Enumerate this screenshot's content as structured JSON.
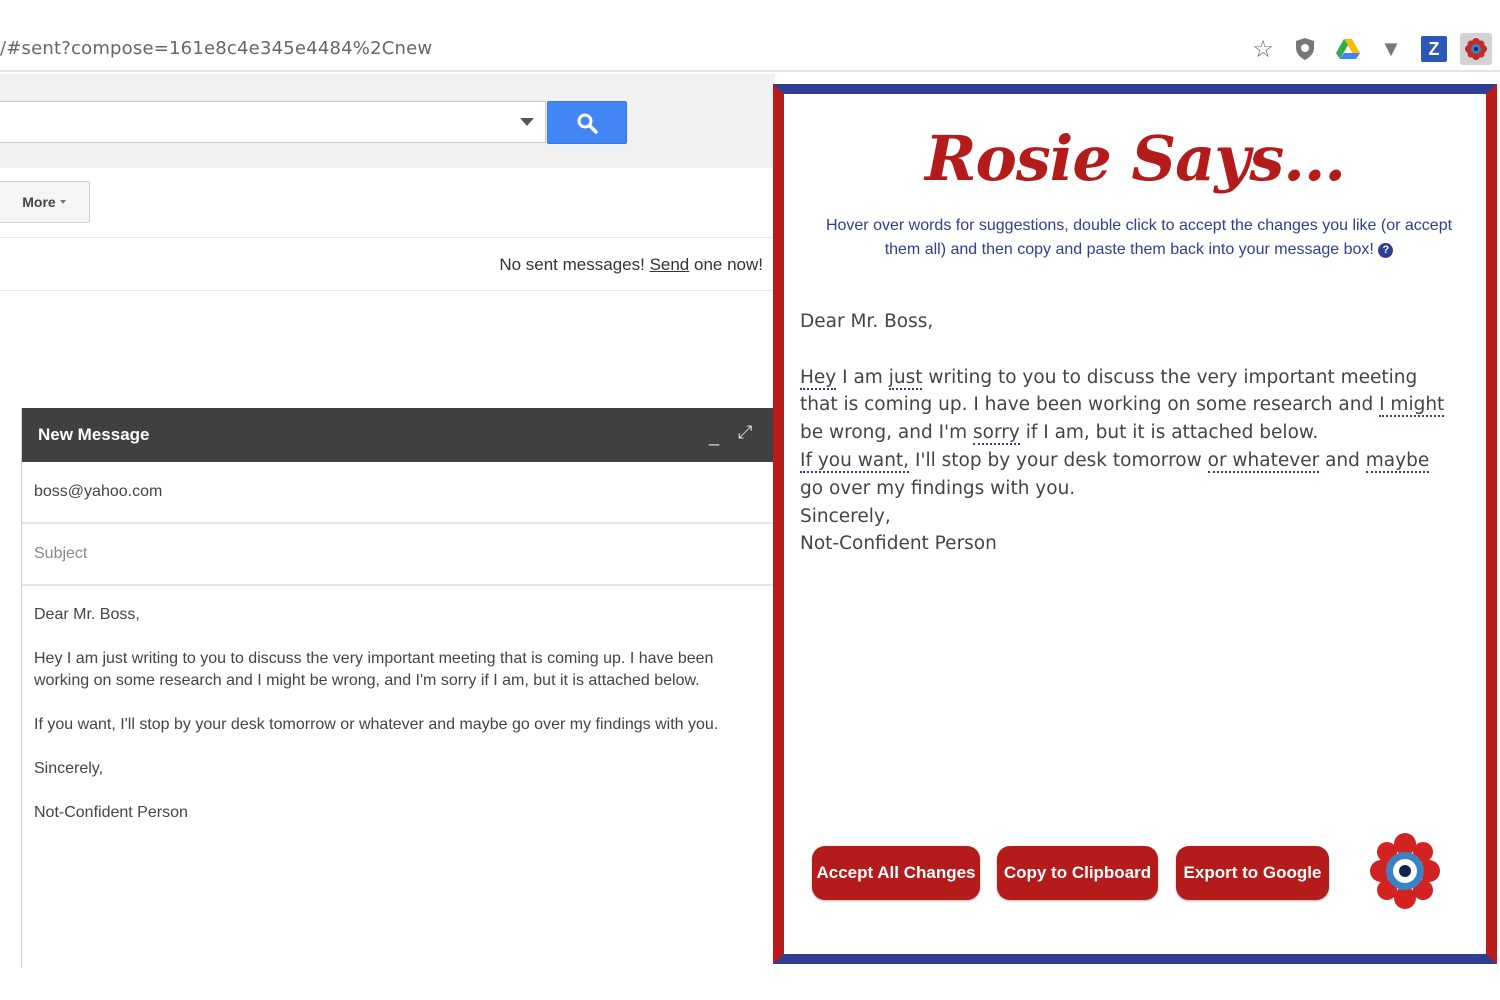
{
  "browser": {
    "url": "/#sent?compose=161e8c4e345e4484%2Cnew",
    "extensions": [
      "star-icon",
      "shield-icon",
      "google-drive-icon",
      "vee-icon",
      "z-icon",
      "rosie-extension-icon"
    ],
    "z_label": "Z"
  },
  "gmail": {
    "more_label": "More",
    "empty_prefix": "No sent messages! ",
    "empty_link": "Send",
    "empty_suffix": " one now!"
  },
  "compose": {
    "title": "New Message",
    "to": "boss@yahoo.com",
    "subject_placeholder": "Subject",
    "body": [
      "Dear Mr. Boss,",
      "Hey I am just writing to you to discuss the very important meeting that is coming up. I have been working on some research and I might be wrong, and I'm sorry if I am, but it is attached below.",
      "If you want, I'll stop by your desk tomorrow or whatever and maybe go over my findings with you.",
      "Sincerely,",
      "Not-Confident Person"
    ]
  },
  "rosie": {
    "title": "Rosie Says...",
    "instructions": "Hover over words for suggestions, double click to accept the changes you like (or accept them all) and then copy and paste them back into your message box!",
    "greeting": "Dear Mr. Boss,",
    "line1": {
      "w_hey": "Hey",
      "t1": " I am ",
      "w_just": "just",
      "t2": " writing to you to discuss the very important meeting that is coming up. I have been working on some research and ",
      "w_might": "I might",
      "t3": " be wrong, and I'm ",
      "w_sorry": "sorry",
      "t4": " if I am, but it is attached below."
    },
    "line2": {
      "w_ifyouwant": "If you want,",
      "t1": " I'll stop by your desk tomorrow ",
      "w_whatever": "or whatever",
      "t2": " and ",
      "w_maybe": "maybe",
      "t3": " go over my findings with you."
    },
    "closing": "Sincerely,",
    "signature": "Not-Confident Person",
    "buttons": {
      "accept": "Accept All Changes",
      "copy": "Copy to Clipboard",
      "export": "Export to Google"
    },
    "colors": {
      "red": "#b41b1b",
      "blue": "#2e3e93"
    }
  }
}
